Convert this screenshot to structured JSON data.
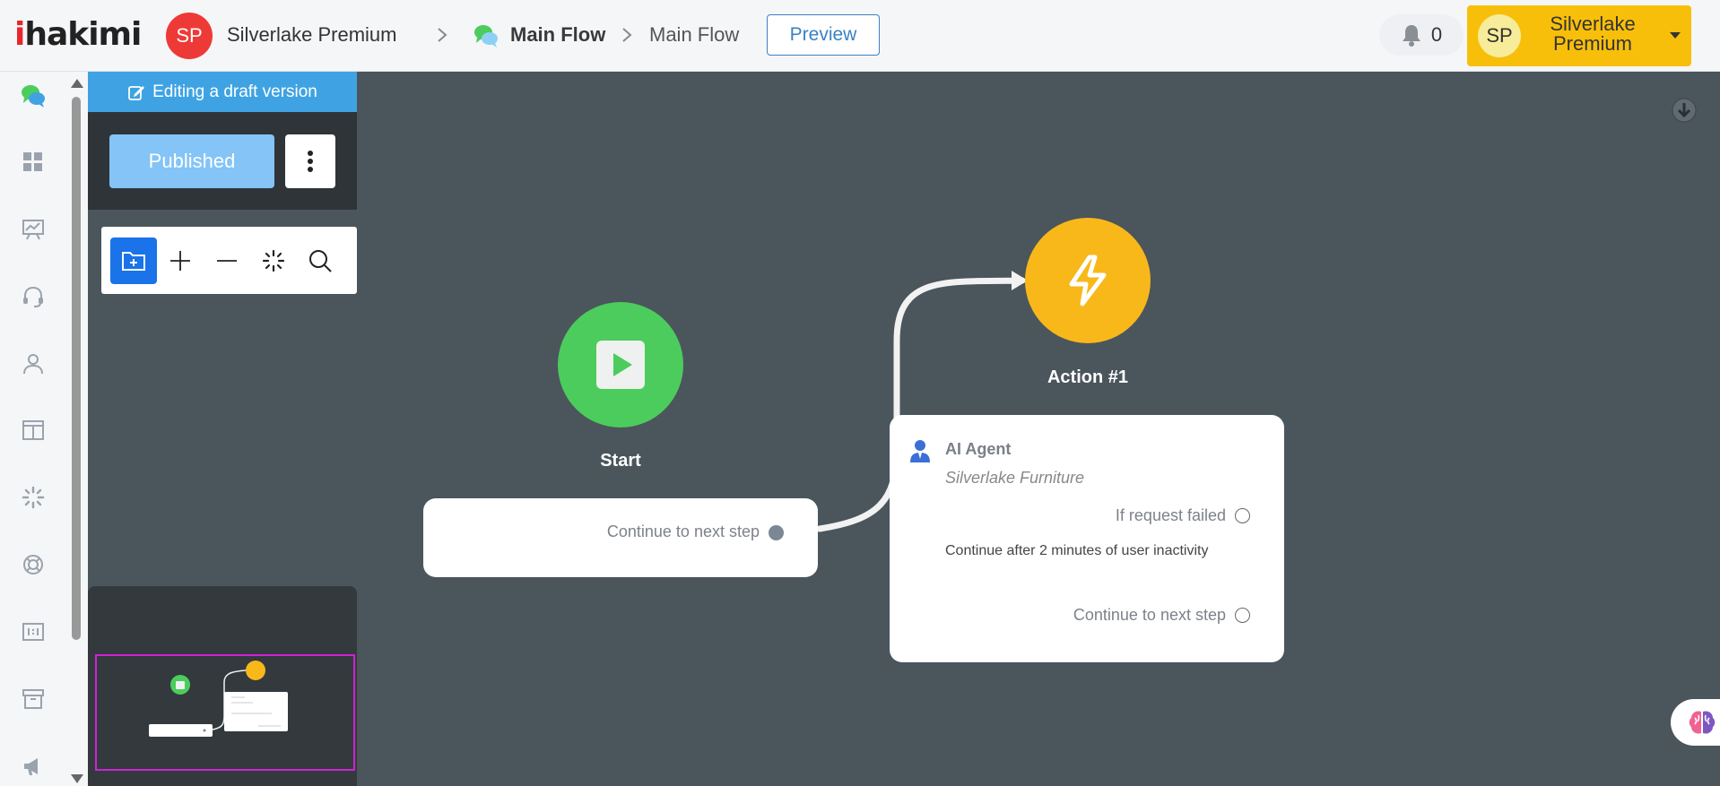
{
  "header": {
    "logo_prefix": "i",
    "logo_rest": "hakimi",
    "company_initials": "SP",
    "company_name": "Silverlake Premium",
    "flow_name": "Main Flow",
    "sub_flow_name": "Main Flow",
    "preview_label": "Preview",
    "notification_count": "0",
    "user_initials": "SP",
    "user_name": "Silverlake Premium"
  },
  "sidebar": {
    "items": [
      {
        "icon": "chat-flow-icon"
      },
      {
        "icon": "dashboard-icon"
      },
      {
        "icon": "analytics-icon"
      },
      {
        "icon": "headset-icon"
      },
      {
        "icon": "user-icon"
      },
      {
        "icon": "layout-icon"
      },
      {
        "icon": "spinner-icon"
      },
      {
        "icon": "lifebuoy-icon"
      },
      {
        "icon": "scale-icon"
      },
      {
        "icon": "archive-icon"
      },
      {
        "icon": "megaphone-icon"
      }
    ]
  },
  "editor": {
    "draft_banner": "Editing a draft version",
    "published_label": "Published",
    "toolbar": [
      "add-folder-icon",
      "zoom-in-icon",
      "zoom-out-icon",
      "auto-layout-icon",
      "search-icon"
    ]
  },
  "nodes": {
    "start": {
      "label": "Start",
      "continue_label": "Continue to next step",
      "color": "#4ccc5c"
    },
    "action": {
      "label": "Action #1",
      "color": "#f8b81a",
      "agent_title": "AI Agent",
      "agent_subtitle": "Silverlake Furniture",
      "failed_label": "If request failed",
      "inactivity_label": "Continue after 2 minutes of user inactivity",
      "continue_label": "Continue to next step"
    }
  },
  "colors": {
    "canvas": "#4b555c",
    "accent": "#3fa3e3",
    "user_menu": "#f8bf0a",
    "minimap_frame": "#d122d6"
  }
}
